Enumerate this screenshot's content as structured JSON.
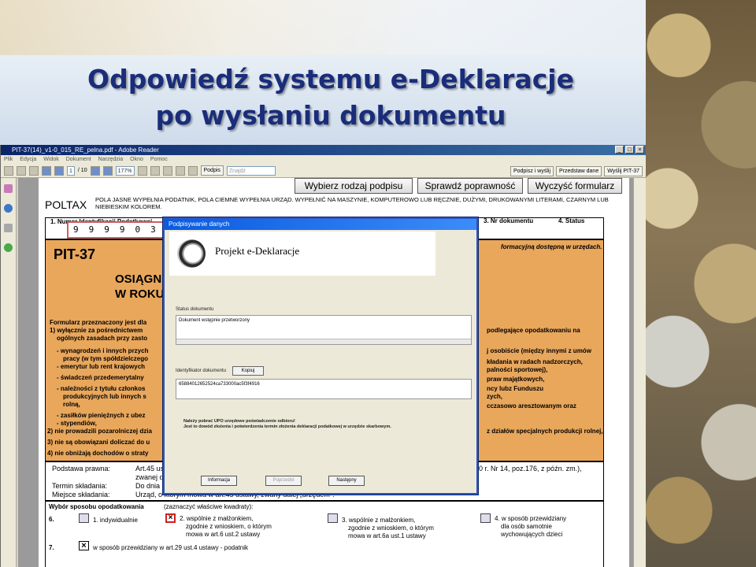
{
  "slide": {
    "title_line1": "Odpowiedź systemu e-Deklaracje",
    "title_line2": "po wysłaniu dokumentu"
  },
  "window": {
    "title": "PIT-37(14)_v1-0_015_RE_pelna.pdf - Adobe Reader",
    "menu": [
      "Plik",
      "Edycja",
      "Widok",
      "Dokument",
      "Narzędzia",
      "Okno",
      "Pomoc"
    ],
    "page_current": "1",
    "page_total": "/ 10",
    "zoom": "177%",
    "sign_label": "Podpis",
    "search_placeholder": "Znajdź",
    "tb_right": [
      "Podpisz i wyślij",
      "Przedstaw dane",
      "Wyślij PIT-37"
    ]
  },
  "form": {
    "buttons": [
      "Wybierz rodzaj podpisu",
      "Sprawdź poprawność",
      "Wyczyść formularz"
    ],
    "brand": "POLTAX",
    "instr": "POLA JASNE WYPEŁNIA PODATNIK, POLA CIEMNE WYPEŁNIA URZĄD. WYPEŁNIĆ NA MASZYNIE, KOMPUTEROWO LUB RĘCZNIE, DUŻYMI, DRUKOWANYMI LITERAMI, CZARNYM LUB NIEBIESKIM KOLOREM.",
    "nip_label": "1. Numer Identyfikacji Podatkowej",
    "nip_digits": "999903",
    "nr_label": "3. Nr dokumentu",
    "status_label": "4. Status",
    "info_right": "formacyjną dostępną w urzędach.",
    "pit": "PIT-37",
    "osign1": "OSIĄGN",
    "osign2": "W ROKU",
    "orange_left": [
      "Formularz przeznaczony jest dla",
      "1) wyłącznie za pośrednictwem",
      "ogólnych zasadach przy zasto",
      "- wynagrodzeń i innych przych",
      "pracy (w tym spółdzielczego",
      "- emerytur lub rent krajowych",
      "- świadczeń przedemerytalny",
      "- należności z tytułu członkos",
      "produkcyjnych lub innych s",
      "rolną,",
      "- zasiłków pieniężnych z ubez",
      "- stypendiów,",
      "2) nie prowadzili pozarolniczej dzia",
      "3) nie są obowiązani doliczać do u",
      "4) nie obniżają dochodów o straty"
    ],
    "orange_right": [
      "podlegające opodatkowaniu na",
      "j osobiście (między innymi z umów",
      "kładania w radach nadzorczych,",
      "palności sportowej),",
      "praw majątkowych,",
      "ncy lubz Funduszu",
      "zych,",
      "cczasowo aresztowanym oraz",
      "z działów specjalnych produkcji rolnej,"
    ],
    "info_rows": [
      {
        "label": "Podstawa prawna:",
        "value": "Art.45 us",
        "tail": "000 r. Nr 14, poz.176, z późn. zm.),"
      },
      {
        "label": "",
        "value": "zwanej d",
        "tail": ""
      },
      {
        "label": "Termin składania:",
        "value": "Do dnia",
        "tail": ""
      },
      {
        "label": "Miejsce składania:",
        "value": "Urząd, o którym mowa w art.45 ustawy, zwany dalej „urzędem\".",
        "tail": ""
      }
    ],
    "sposob_title": "Wybór sposobu opodatkowania",
    "sposob_hint": "(zaznaczyć właściwe kwadraty):",
    "row6": "6.",
    "opt1": "1. indywidualnie",
    "opt2a": "2. wspólnie z małżonkiem,",
    "opt2b": "zgodnie z wnioskiem, o którym",
    "opt2c": "mowa w art.6 ust.2 ustawy",
    "opt3a": "3. wspólnie z małżonkiem,",
    "opt3b": "zgodnie z wnioskiem, o którym",
    "opt3c": "mowa w art.6a ust.1 ustawy",
    "opt4a": "4. w sposób przewidziany",
    "opt4b": "dla osób samotnie",
    "opt4c": "wychowujących dzieci",
    "row7": "7.",
    "row7text": "w sposób przewidziany w art.29 ust.4 ustawy - podatnik"
  },
  "dialog": {
    "title": "Podpisywanie danych",
    "brand": "Projekt  e-Deklaracje",
    "status_label": "Status dokumentu",
    "status_value": "Dokument wstępnie przetworzony",
    "id_label": "Identyfikator dokumentu",
    "copy_button": "Kopiuj",
    "id_value": "65884012652524ca733000ac5f3f4916",
    "msg1": "Należy pobrać UPO urzędowe poświadczenie odbioru!",
    "msg2": "Jest to dowód złożenia i potwierdzenia termin złożenia deklaracji podatkowej w urzędzie skarbowym.",
    "btn_info": "Informacja",
    "btn_prev": "Poprzedni",
    "btn_next": "Następny"
  }
}
